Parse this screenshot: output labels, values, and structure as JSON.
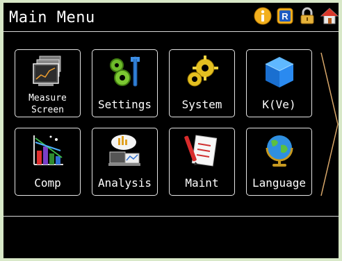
{
  "header": {
    "title": "Main Menu",
    "icons": [
      "info-icon",
      "r-badge-icon",
      "lock-icon",
      "home-icon"
    ]
  },
  "menu": {
    "items": [
      {
        "label": "Measure\nScreen",
        "icon": "measure-screen-icon"
      },
      {
        "label": "Settings",
        "icon": "settings-icon"
      },
      {
        "label": "System",
        "icon": "system-gears-icon"
      },
      {
        "label": "K(Ve)",
        "icon": "cube-icon"
      },
      {
        "label": "Comp",
        "icon": "comp-chart-icon"
      },
      {
        "label": "Analysis",
        "icon": "analysis-icon"
      },
      {
        "label": "Maint",
        "icon": "maint-clipboard-icon"
      },
      {
        "label": "Language",
        "icon": "globe-icon"
      }
    ]
  },
  "colors": {
    "background": "#000000",
    "text": "#ffffff",
    "border": "#e6e6e6",
    "arrow": "#d9a86a",
    "frame": "#d8e8c8"
  }
}
